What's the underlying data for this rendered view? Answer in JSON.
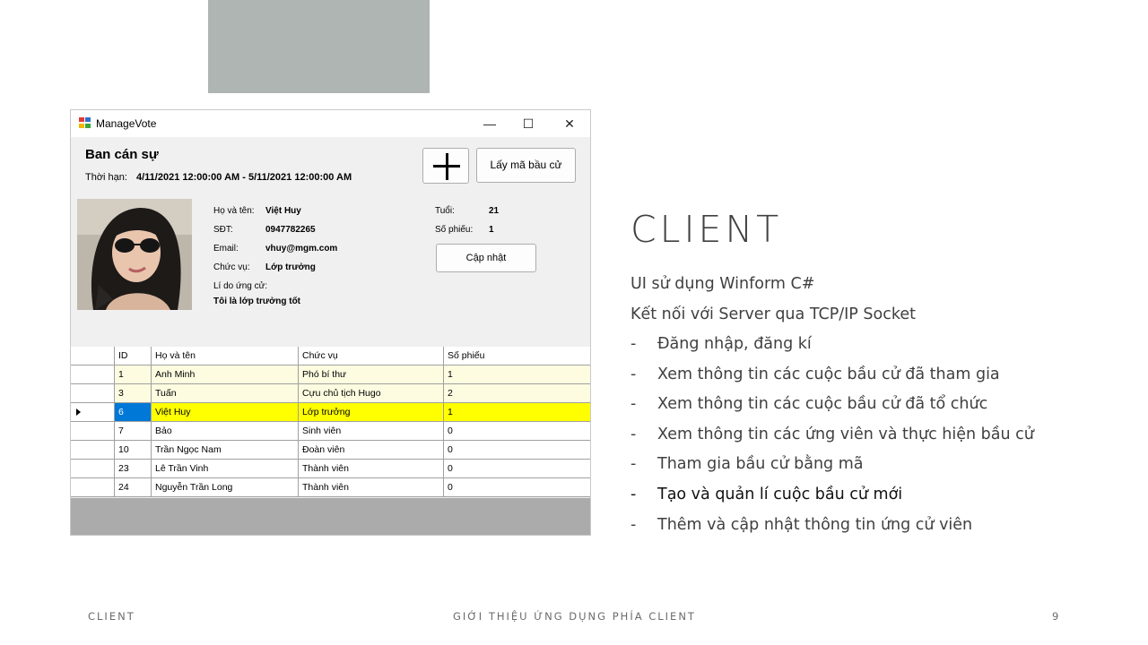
{
  "window": {
    "title": "ManageVote",
    "minimize": "—",
    "maximize": "☐",
    "close": "✕"
  },
  "vote": {
    "name": "Ban cán sự",
    "period_label": "Thời hạn:",
    "period_value": "4/11/2021 12:00:00 AM - 5/11/2021 12:00:00 AM",
    "get_code_button": "Lấy mã bầu cử",
    "update_button": "Cập nhật"
  },
  "candidate": {
    "name_label": "Họ và tên:",
    "name": "Việt Huy",
    "phone_label": "SĐT:",
    "phone": "0947782265",
    "email_label": "Email:",
    "email": "vhuy@mgm.com",
    "position_label": "Chức vụ:",
    "position": "Lớp trưởng",
    "reason_label": "Lí do ứng cử:",
    "reason": "Tôi là lớp trưởng tốt",
    "age_label": "Tuổi:",
    "age": "21",
    "votes_label": "Số phiếu:",
    "votes": "1"
  },
  "grid": {
    "columns": [
      "ID",
      "Họ và tên",
      "Chức vụ",
      "Số phiếu"
    ],
    "rows": [
      {
        "id": "1",
        "name": "Anh Minh",
        "position": "Phó bí thư",
        "votes": "1"
      },
      {
        "id": "3",
        "name": "Tuấn",
        "position": "Cựu chủ tịch Hugo",
        "votes": "2"
      },
      {
        "id": "6",
        "name": "Việt Huy",
        "position": "Lớp trưởng",
        "votes": "1"
      },
      {
        "id": "7",
        "name": "Bảo",
        "position": "Sinh viên",
        "votes": "0"
      },
      {
        "id": "10",
        "name": "Trần Ngọc Nam",
        "position": "Đoàn viên",
        "votes": "0"
      },
      {
        "id": "23",
        "name": "Lê Trần Vinh",
        "position": "Thành viên",
        "votes": "0"
      },
      {
        "id": "24",
        "name": "Nguyễn Trần Long",
        "position": "Thành viên",
        "votes": "0"
      }
    ],
    "selected_row": 2
  },
  "slide": {
    "heading": "CLIENT",
    "lines": [
      "UI sử dụng Winform C#",
      "Kết nối với Server qua TCP/IP Socket"
    ],
    "bullets": [
      "Đăng nhập, đăng kí",
      "Xem thông tin các cuộc bầu cử đã tham gia",
      "Xem thông tin các cuộc bầu cử đã tổ chức",
      "Xem thông tin các ứng viên và thực hiện bầu cử",
      "Tham gia bầu cử bằng mã",
      "Tạo và quản lí cuộc bầu cử mới",
      "Thêm và cập nhật thông tin ứng cử viên"
    ],
    "bullet_dash": "-"
  },
  "footer": {
    "left": "CLIENT",
    "center": "GIỚI THIỆU ỨNG DỤNG PHÍA CLIENT",
    "page": "9"
  },
  "colors": {
    "alt_row": "#fefce0",
    "selected_id": "#0078d7",
    "selected_rest": "#ffff00",
    "deco": "#aeb5b3"
  }
}
